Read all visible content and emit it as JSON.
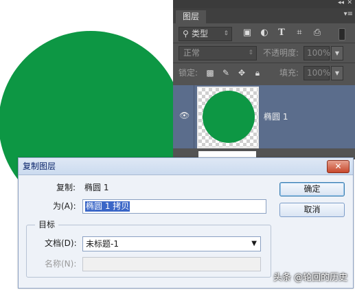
{
  "colors": {
    "shape_fill": "#0d9744",
    "layer_selected": "#5b6d8c",
    "panel_bg": "#535353"
  },
  "layers_panel": {
    "tab_label": "图层",
    "filter_label": "类型",
    "filter_icons": [
      "image-filter-icon",
      "adjustment-filter-icon",
      "type-filter-icon",
      "shape-filter-icon",
      "smart-object-filter-icon"
    ],
    "blend_mode": "正常",
    "opacity_label": "不透明度:",
    "opacity_value": "100%",
    "lock_label": "锁定:",
    "lock_icons": [
      "lock-transparent-icon",
      "lock-image-icon",
      "lock-position-icon",
      "lock-all-icon"
    ],
    "fill_label": "填充:",
    "fill_value": "100%",
    "layers": [
      {
        "name": "椭圆 1",
        "visible": true,
        "selected": true
      }
    ]
  },
  "dialog": {
    "title": "复制图层",
    "copy_label": "复制:",
    "copy_value": "椭圆 1",
    "as_label": "为(A):",
    "as_value": "椭圆 1 拷贝",
    "destination_legend": "目标",
    "document_label": "文档(D):",
    "document_value": "未标题-1",
    "name_label": "名称(N):",
    "name_value": "",
    "ok_label": "确定",
    "cancel_label": "取消"
  },
  "watermark": "头条 @轮回的历史"
}
